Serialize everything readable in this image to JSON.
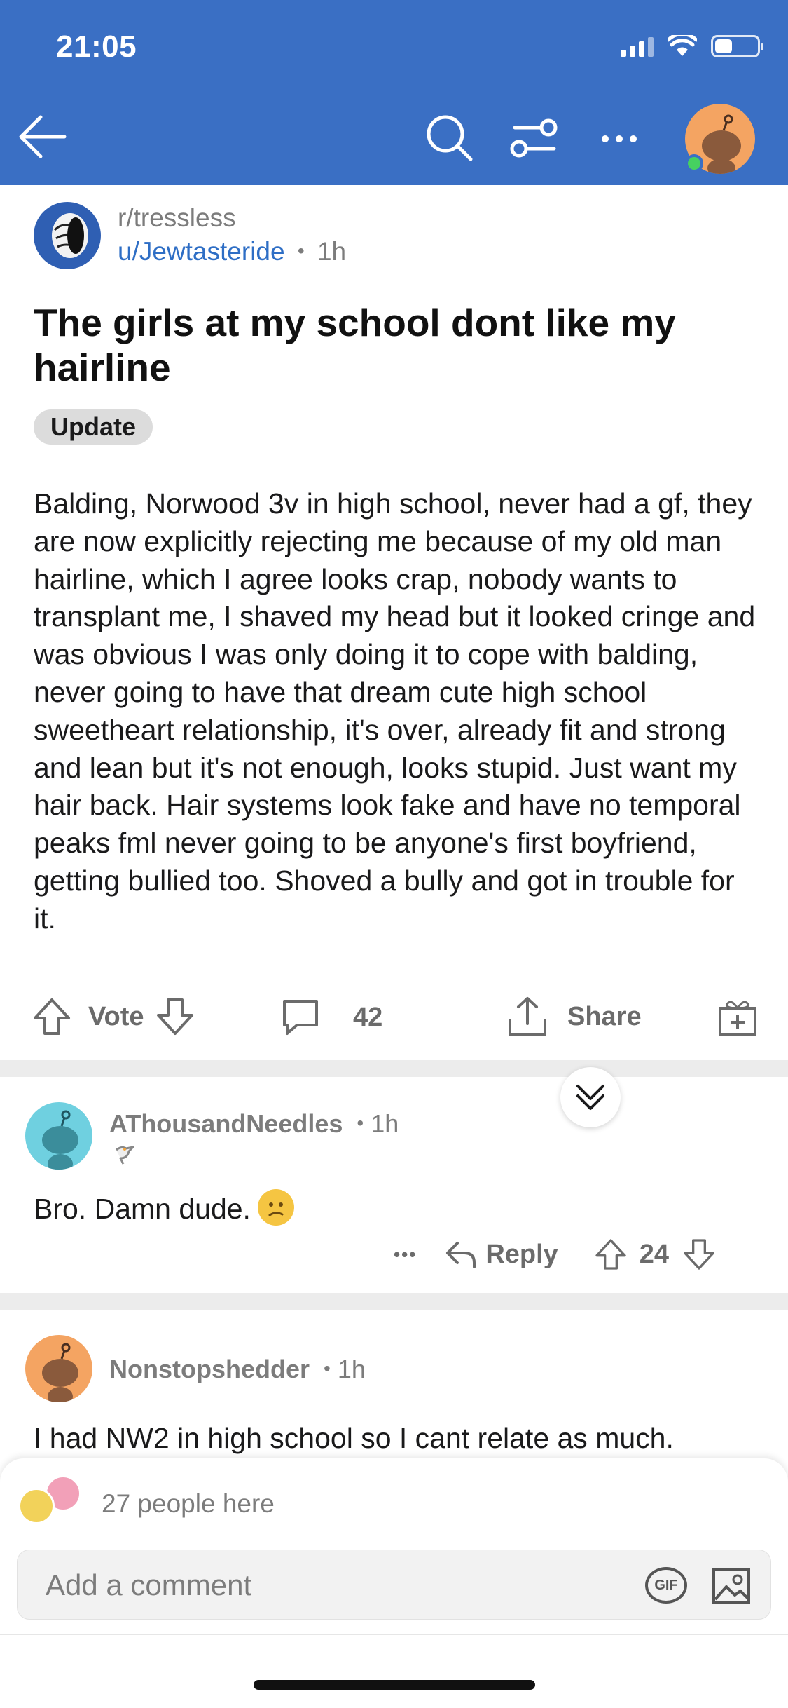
{
  "status_bar": {
    "time": "21:05"
  },
  "post": {
    "subreddit": "r/tressless",
    "author": "u/Jewtasteride",
    "separator": "•",
    "age": "1h",
    "title": "The girls at my school dont like my hairline",
    "flair": "Update",
    "body": "Balding, Norwood 3v in high school, never had a gf, they are now explicitly rejecting me because of my old man hairline, which I agree looks crap, nobody wants to transplant me, I shaved my head but it looked cringe and was obvious I was only doing it to cope with balding, never going to have that dream cute high school sweetheart relationship, it's over, already fit and strong and lean but it's not enough, looks stupid. Just want my hair back. Hair systems look fake and have no temporal peaks fml never going to be anyone's first boyfriend, getting bullied too. Shoved a bully and got in trouble for it.",
    "vote_label": "Vote",
    "comment_count": "42",
    "share_label": "Share"
  },
  "comments": [
    {
      "author": "AThousandNeedles",
      "age": "1h",
      "text": "Bro. Damn dude.",
      "reply_label": "Reply",
      "score": "24",
      "more": "•••"
    },
    {
      "author": "Nonstopshedder",
      "age": "1h",
      "text": "I had NW2 in high school so I cant relate as much."
    }
  ],
  "composer": {
    "people_here": "27 people here",
    "placeholder": "Add a comment",
    "gif_label": "GIF"
  },
  "colors": {
    "header_bg": "#3a6fc4",
    "link_blue": "#2e6ec5",
    "online_green": "#46d160"
  }
}
